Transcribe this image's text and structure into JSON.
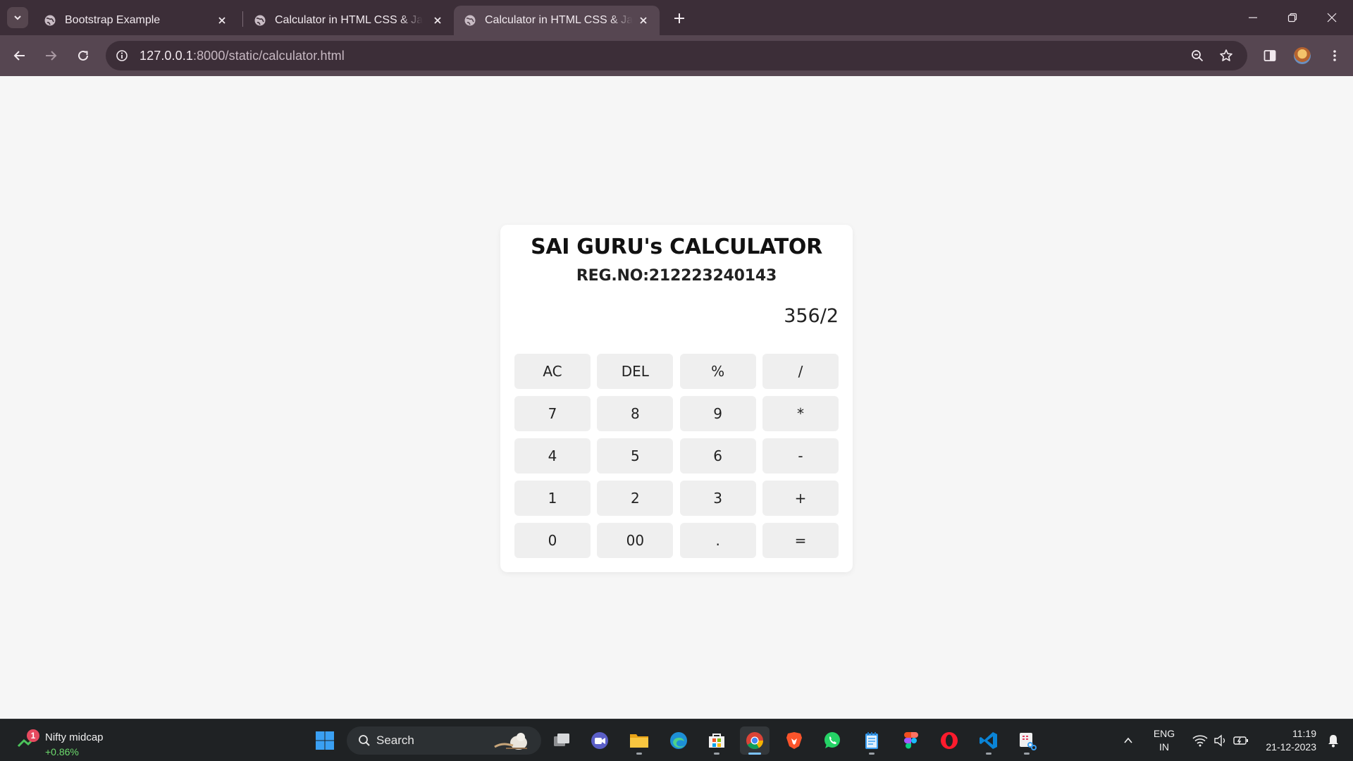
{
  "browser": {
    "tabs": [
      {
        "title": "Bootstrap Example",
        "active": false
      },
      {
        "title": "Calculator in HTML CSS & JavaScript",
        "active": false
      },
      {
        "title": "Calculator in HTML CSS & JavaScript",
        "active": true
      }
    ],
    "url_host": "127.0.0.1",
    "url_path": ":8000/static/calculator.html"
  },
  "calculator": {
    "title": "SAI GURU's CALCULATOR",
    "reg_no": "REG.NO:212223240143",
    "display": "356/2",
    "keys": [
      [
        "AC",
        "DEL",
        "%",
        "/"
      ],
      [
        "7",
        "8",
        "9",
        "*"
      ],
      [
        "4",
        "5",
        "6",
        "-"
      ],
      [
        "1",
        "2",
        "3",
        "+"
      ],
      [
        "0",
        "00",
        ".",
        "="
      ]
    ]
  },
  "taskbar": {
    "widget": {
      "badge": "1",
      "title": "Nifty midcap",
      "change": "+0.86%"
    },
    "search_label": "Search",
    "language": {
      "line1": "ENG",
      "line2": "IN"
    },
    "clock": {
      "time": "11:19",
      "date": "21-12-2023"
    }
  },
  "colors": {
    "tab_strip": "#3c2e38",
    "toolbar": "#564651",
    "page_background": "#f6f6f6",
    "calculator_card": "#ffffff",
    "key_background": "#efefef",
    "taskbar": "#1f2224"
  }
}
